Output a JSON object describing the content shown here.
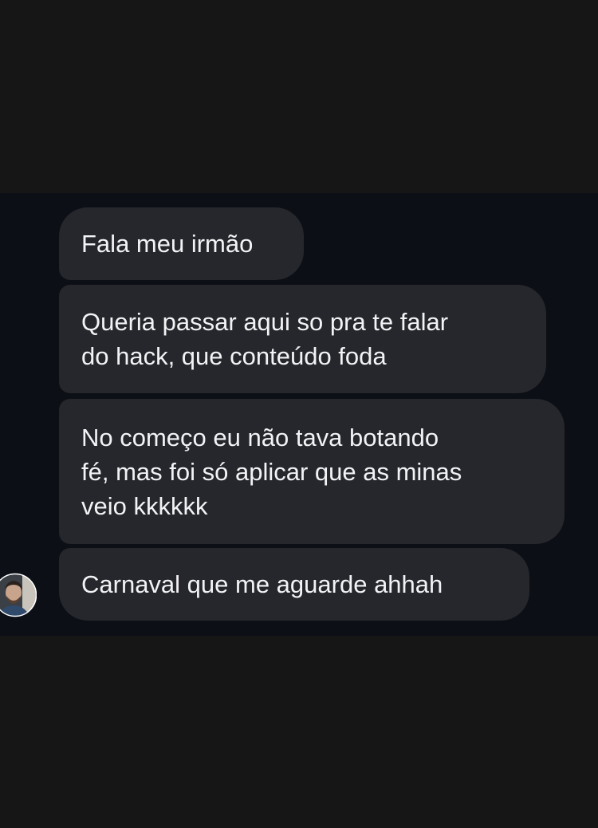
{
  "conversation": {
    "messages": [
      {
        "text": "Fala meu irmão"
      },
      {
        "text": "Queria passar aqui so pra te falar\ndo hack, que conteúdo foda"
      },
      {
        "text": "No começo eu não tava botando\nfé, mas foi só aplicar que as minas\nveio kkkkkk"
      },
      {
        "text": "Carnaval que me aguarde ahhah"
      }
    ],
    "sender_avatar": {
      "icon": "user-avatar-photo"
    }
  },
  "colors": {
    "background": "#161616",
    "chat_background": "#0c0f16",
    "bubble": "#25272c",
    "bubble_text": "#f2f3f5"
  }
}
